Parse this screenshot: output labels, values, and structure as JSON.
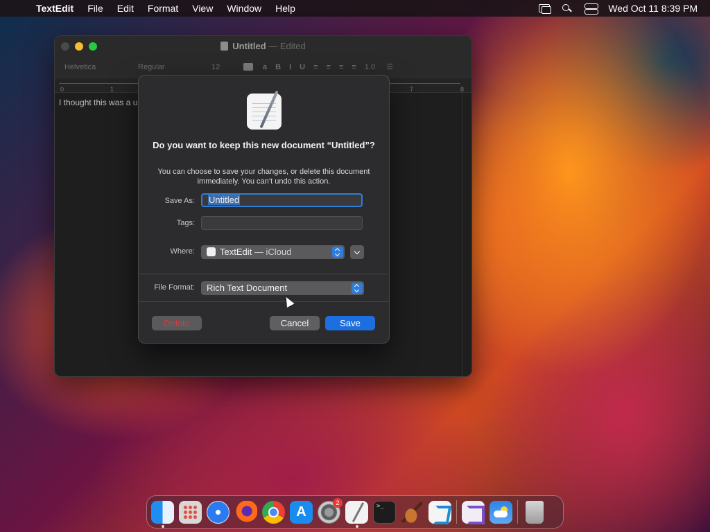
{
  "menubar": {
    "apple": "",
    "app_name": "TextEdit",
    "items": [
      "File",
      "Edit",
      "Format",
      "View",
      "Window",
      "Help"
    ],
    "clock": "Wed Oct 11  8:39 PM"
  },
  "window": {
    "title": "Untitled",
    "title_state": "— Edited",
    "toolbar": {
      "font": "Helvetica",
      "style": "Regular",
      "size": "12",
      "bold": "B",
      "italic": "I",
      "underline": "U",
      "line_spacing": "1.0"
    },
    "ruler": {
      "ticks": [
        "0",
        "1",
        "7",
        "8"
      ]
    },
    "doc_text": "I thought this was a u"
  },
  "dialog": {
    "title": "Do you want to keep this new document “Untitled”?",
    "message": "You can choose to save your changes, or delete this document immediately. You can’t undo this action.",
    "save_as_label": "Save As:",
    "save_as_value": "Untitled",
    "tags_label": "Tags:",
    "where_label": "Where:",
    "where_value": "TextEdit",
    "where_suffix": "— iCloud",
    "file_format_label": "File Format:",
    "file_format_value": "Rich Text Document",
    "delete_label": "Delete",
    "cancel_label": "Cancel",
    "save_label": "Save"
  },
  "dock": {
    "settings_badge": "2"
  },
  "colors": {
    "accent": "#1d6fe0",
    "delete_text": "#d23c3c"
  }
}
